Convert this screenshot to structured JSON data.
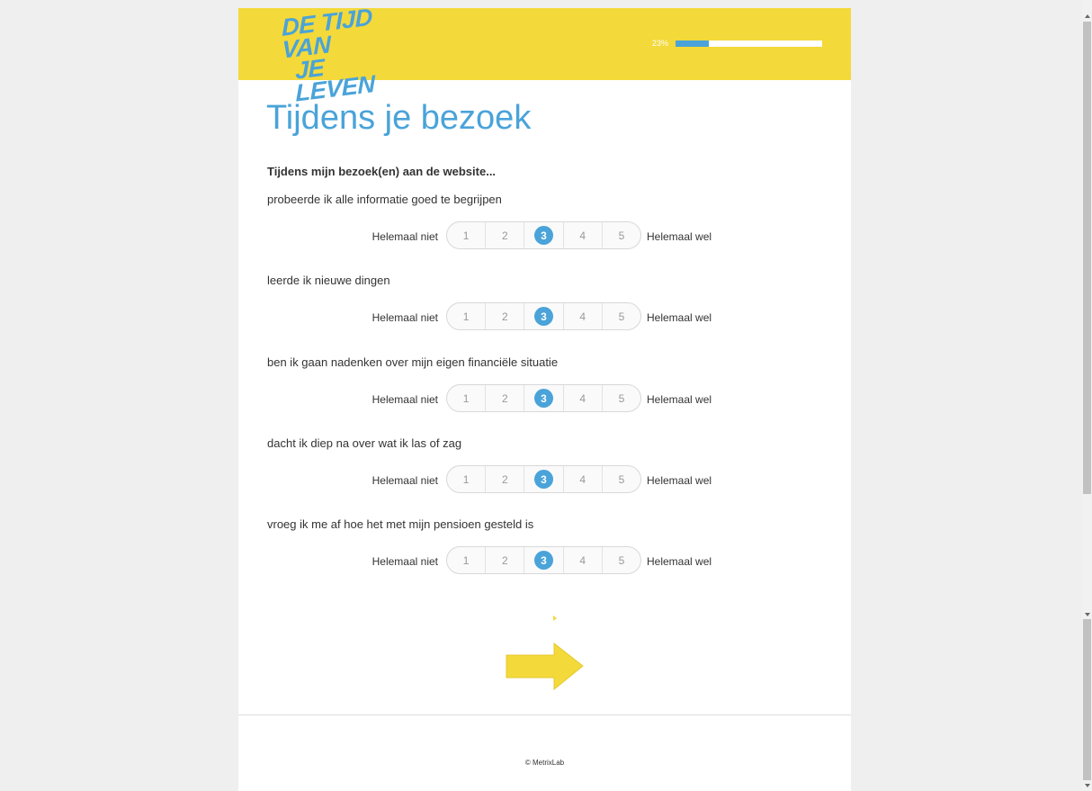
{
  "header": {
    "logo_line1": "DE TIJD VAN",
    "logo_line2": "JE LEVEN",
    "progress_text": "23%",
    "progress_value": 0.23
  },
  "page_title": "Tijdens je bezoek",
  "section_intro": "Tijdens mijn bezoek(en) aan de website...",
  "scale": {
    "low_label": "Helemaal niet",
    "high_label": "Helemaal wel",
    "options": [
      "1",
      "2",
      "3",
      "4",
      "5"
    ]
  },
  "questions": [
    {
      "text": "probeerde ik alle informatie goed te begrijpen",
      "selected": "3"
    },
    {
      "text": "leerde ik nieuwe dingen",
      "selected": "3"
    },
    {
      "text": "ben ik gaan nadenken over mijn eigen financiële situatie",
      "selected": "3"
    },
    {
      "text": "dacht ik diep na over wat ik las of zag",
      "selected": "3"
    },
    {
      "text": "vroeg ik me af hoe het met mijn pensioen gesteld is",
      "selected": "3"
    }
  ],
  "navigation": {
    "next_icon": "arrow-right-icon"
  },
  "footer": {
    "copyright": "© MetrixLab"
  },
  "colors": {
    "accent": "#4aa3d9",
    "brand_yellow": "#f3d93a"
  }
}
